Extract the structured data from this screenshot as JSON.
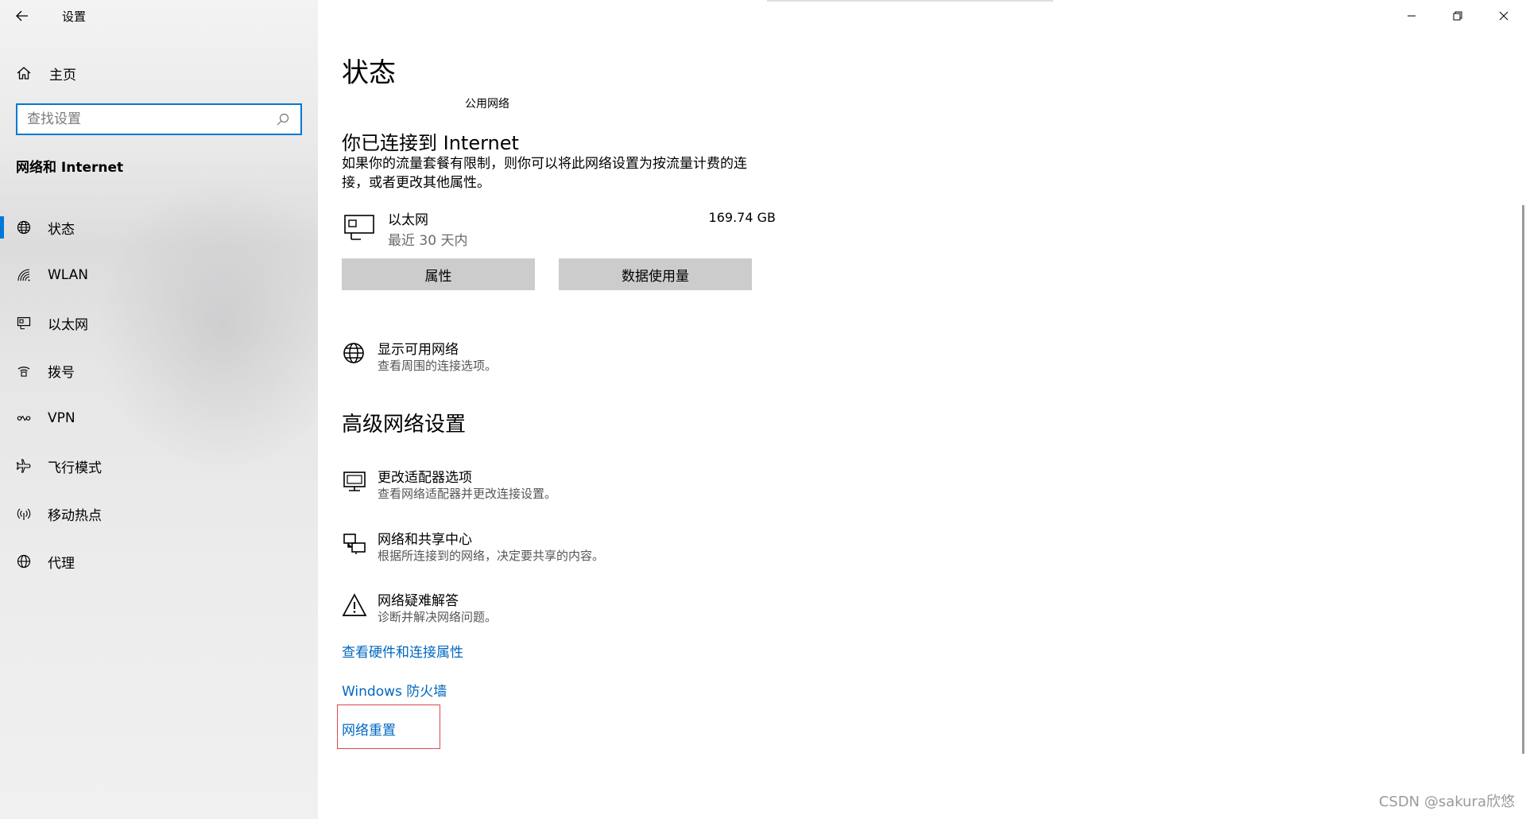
{
  "window": {
    "title": "设置"
  },
  "sidebar": {
    "home_label": "主页",
    "search_placeholder": "查找设置",
    "section_title": "网络和 Internet",
    "items": [
      {
        "label": "状态",
        "icon": "globe-icon",
        "active": true
      },
      {
        "label": "WLAN",
        "icon": "wifi-icon",
        "active": false
      },
      {
        "label": "以太网",
        "icon": "ethernet-icon",
        "active": false
      },
      {
        "label": "拨号",
        "icon": "dialup-icon",
        "active": false
      },
      {
        "label": "VPN",
        "icon": "vpn-icon",
        "active": false
      },
      {
        "label": "飞行模式",
        "icon": "airplane-icon",
        "active": false
      },
      {
        "label": "移动热点",
        "icon": "hotspot-icon",
        "active": false
      },
      {
        "label": "代理",
        "icon": "proxy-globe-icon",
        "active": false
      }
    ]
  },
  "main": {
    "page_title": "状态",
    "network_type": "公用网络",
    "connection_title": "你已连接到 Internet",
    "connection_desc": "如果你的流量套餐有限制，则你可以将此网络设置为按流量计费的连接，或者更改其他属性。",
    "adapter": {
      "name": "以太网",
      "period": "最近 30 天内",
      "usage": "169.74 GB"
    },
    "buttons": {
      "properties": "属性",
      "data_usage": "数据使用量"
    },
    "show_networks": {
      "title": "显示可用网络",
      "subtitle": "查看周围的连接选项。"
    },
    "advanced_title": "高级网络设置",
    "advanced_items": [
      {
        "title": "更改适配器选项",
        "subtitle": "查看网络适配器并更改连接设置。",
        "icon": "monitor-icon"
      },
      {
        "title": "网络和共享中心",
        "subtitle": "根据所连接到的网络，决定要共享的内容。",
        "icon": "sharing-center-icon"
      },
      {
        "title": "网络疑难解答",
        "subtitle": "诊断并解决网络问题。",
        "icon": "warning-icon"
      }
    ],
    "links": {
      "hardware": "查看硬件和连接属性",
      "firewall": "Windows 防火墙",
      "reset": "网络重置"
    }
  },
  "watermark": "CSDN @sakura欣悠"
}
